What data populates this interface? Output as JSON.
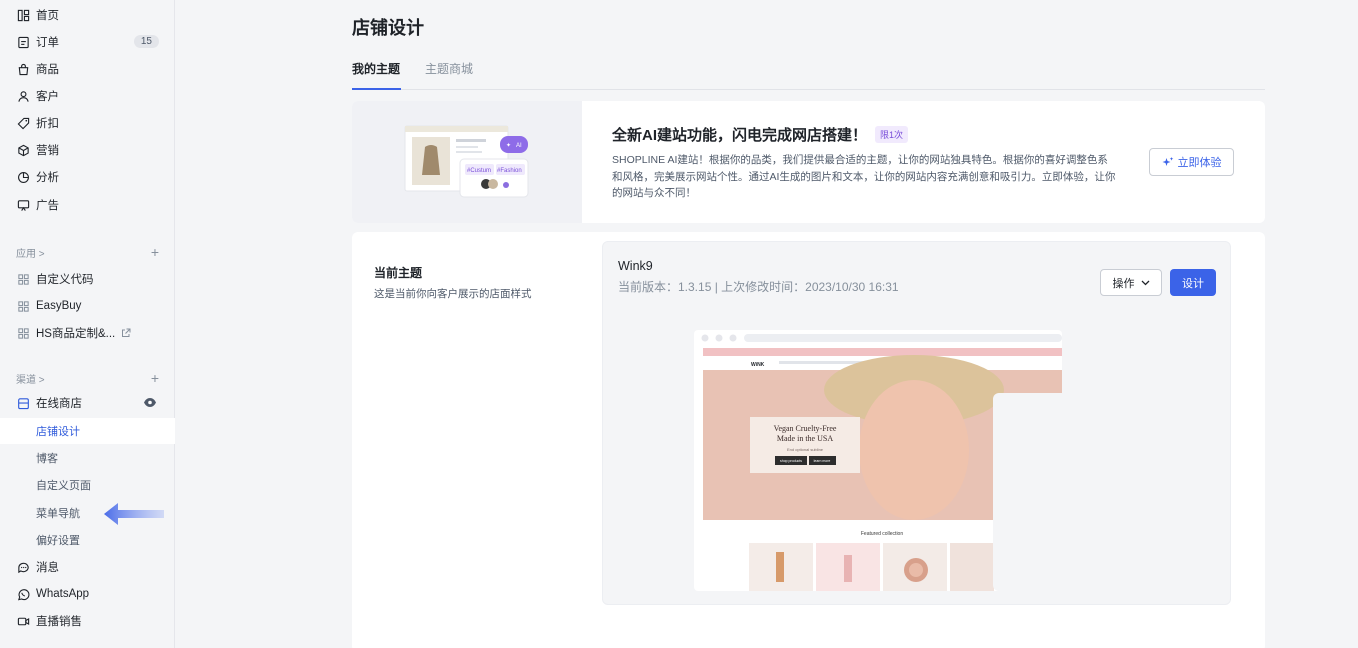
{
  "sidebar": {
    "main_items": [
      {
        "label": "首页",
        "icon": "home-icon"
      },
      {
        "label": "订单",
        "icon": "order-icon",
        "badge": "15"
      },
      {
        "label": "商品",
        "icon": "bag-icon"
      },
      {
        "label": "客户",
        "icon": "user-icon"
      },
      {
        "label": "折扣",
        "icon": "tag-icon"
      },
      {
        "label": "营销",
        "icon": "cube-icon"
      },
      {
        "label": "分析",
        "icon": "pie-chart-icon"
      },
      {
        "label": "广告",
        "icon": "ad-icon"
      }
    ],
    "apps_section": {
      "label": "应用 >",
      "plus": "+"
    },
    "apps": [
      {
        "label": "自定义代码",
        "icon": "app-grid-icon"
      },
      {
        "label": "EasyBuy",
        "icon": "app-grid-icon"
      },
      {
        "label": "HS商品定制&...",
        "icon": "app-grid-icon"
      }
    ],
    "channels_section": {
      "label": "渠道 >",
      "plus": "+"
    },
    "online_store": {
      "label": "在线商店",
      "icon": "store-icon"
    },
    "store_sub_items": [
      {
        "label": "店铺设计",
        "active": true
      },
      {
        "label": "博客"
      },
      {
        "label": "自定义页面"
      },
      {
        "label": "菜单导航"
      },
      {
        "label": "偏好设置"
      }
    ],
    "bottom_items": [
      {
        "label": "消息",
        "icon": "chat-icon"
      },
      {
        "label": "WhatsApp",
        "icon": "whatsapp-icon"
      },
      {
        "label": "直播销售",
        "icon": "live-icon"
      }
    ]
  },
  "page": {
    "title": "店铺设计",
    "tabs": [
      {
        "label": "我的主题",
        "active": true
      },
      {
        "label": "主题商城",
        "active": false
      }
    ]
  },
  "promo": {
    "title": "全新AI建站功能，闪电完成网店搭建！",
    "tag": "限1次",
    "description": "SHOPLINE AI建站！根据你的品类，我们提供最合适的主题，让你的网站独具特色。根据你的喜好调整色系和风格，完美展示网站个性。通过AI生成的图片和文本，让你的网站内容充满创意和吸引力。立即体验，让你的网站与众不同！",
    "button": "立即体验",
    "art": {
      "ai_badge": "AI",
      "chip1": "#Custum",
      "chip2": "#Fashion"
    }
  },
  "current_theme": {
    "title": "当前主题",
    "description": "这是当前你向客户展示的店面样式",
    "name": "Wink9",
    "meta": "当前版本：1.3.15 | 上次修改时间：2023/10/30 16:31",
    "ops_button": "操作",
    "design_button": "设计",
    "preview": {
      "hero_line1": "Vegan Cruelty-Free",
      "hero_line2": "Made in the USA",
      "hero_sub": "End optional subline",
      "btn1": "shop products",
      "btn2": "learn more",
      "collection": "Featured collection",
      "logo": "WiNK"
    }
  },
  "colors": {
    "accent": "#3b63e8",
    "arrow": "#5b7bea",
    "promo_tag": "#7a4fd9"
  }
}
